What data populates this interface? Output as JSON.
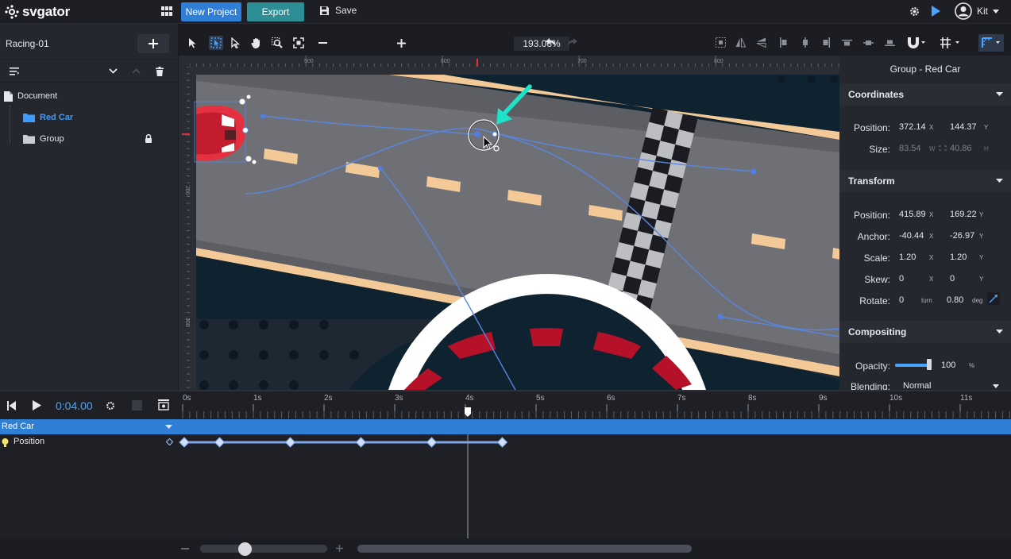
{
  "app": {
    "logo_text": "svgator",
    "new_project_label": "New Project",
    "export_label": "Export",
    "save_label": "Save",
    "user_name": "Kit"
  },
  "project": {
    "name": "Racing-01"
  },
  "layers": {
    "root_label": "Document",
    "items": [
      {
        "label": "Red Car",
        "selected": true,
        "icon": "folder-icon"
      },
      {
        "label": "Group",
        "selected": false,
        "icon": "folder-icon",
        "locked": true
      }
    ]
  },
  "canvas_toolbar": {
    "zoom": "193.06%"
  },
  "rulers": {
    "top_labels": [
      "500",
      "600",
      "700",
      "800"
    ],
    "left_labels": [
      "200",
      "300"
    ]
  },
  "inspector": {
    "title": "Group - Red Car",
    "coordinates": {
      "heading": "Coordinates",
      "position_label": "Position:",
      "position_x": "372.14",
      "position_y": "144.37",
      "size_label": "Size:",
      "size_w": "83.54",
      "size_h": "40.86",
      "unit_x": "X",
      "unit_y": "Y",
      "unit_w": "W",
      "unit_h": "H"
    },
    "transform": {
      "heading": "Transform",
      "position_label": "Position:",
      "position_x": "415.89",
      "position_y": "169.22",
      "anchor_label": "Anchor:",
      "anchor_x": "-40.44",
      "anchor_y": "-26.97",
      "scale_label": "Scale:",
      "scale_x": "1.20",
      "scale_y": "1.20",
      "skew_label": "Skew:",
      "skew_x": "0",
      "skew_y": "0",
      "rotate_label": "Rotate:",
      "rotate_turn": "0",
      "rotate_deg": "0.80",
      "unit_turn": "turn",
      "unit_deg": "deg"
    },
    "compositing": {
      "heading": "Compositing",
      "opacity_label": "Opacity:",
      "opacity_value": "100",
      "opacity_unit": "%",
      "opacity_fraction": 1.0,
      "blending_label": "Blending:",
      "blending_value": "Normal"
    }
  },
  "timeline": {
    "current_time": "0:04.00",
    "ticks": [
      "0s",
      "1s",
      "2s",
      "3s",
      "4s",
      "5s",
      "6s",
      "7s",
      "8s",
      "9s",
      "10s",
      "11s"
    ],
    "selected_track": "Red Car",
    "property_track": "Position",
    "keyframes_seconds": [
      0,
      0.5,
      1.5,
      2.5,
      3.5,
      4.5
    ],
    "playhead_seconds": 4.0
  },
  "colors": {
    "accent_blue": "#2f7fd6",
    "export_teal": "#2d8f95",
    "arrow_cyan": "#1ee3c8",
    "car_red": "#e5303f",
    "road_gray": "#6f7075",
    "lane_tan": "#f2c997"
  }
}
